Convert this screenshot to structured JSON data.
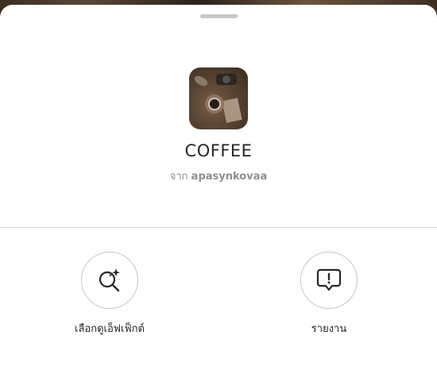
{
  "effect": {
    "name": "COFFEE",
    "byline_prefix": "จาก",
    "author": "apasynkovaa"
  },
  "actions": {
    "browse_label": "เลือกดูเอ็ฟเฟ็กต์",
    "report_label": "รายงาน"
  },
  "icons": {
    "browse": "sparkle-search-icon",
    "report": "exclamation-speech-bubble-icon"
  },
  "colors": {
    "text_primary": "#262626",
    "text_secondary": "#8e8e8e",
    "border": "#c7c7c7"
  }
}
